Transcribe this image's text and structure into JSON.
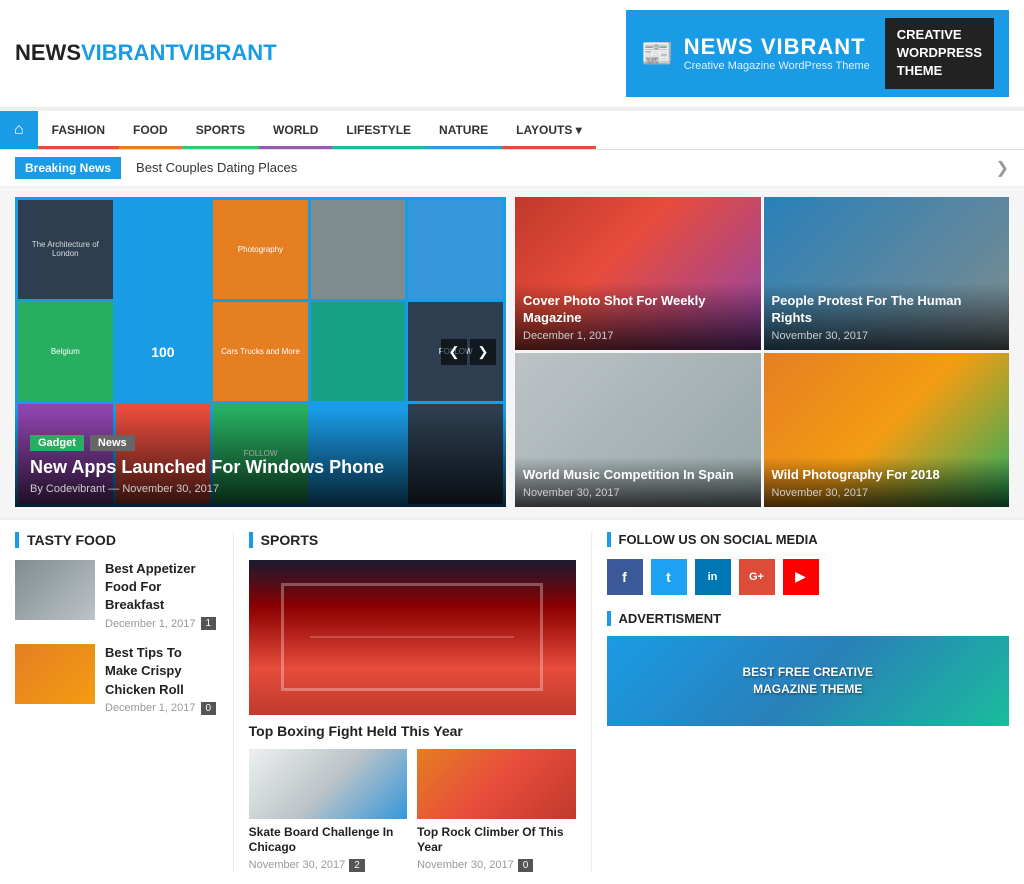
{
  "header": {
    "logo_news": "NEWS",
    "logo_vibrant": "VIBRANT",
    "banner_title": "NEWS VIBRANT",
    "banner_subtitle": "Creative Magazine WordPress Theme",
    "banner_right_line1": "CREATIVE",
    "banner_right_line2": "WORDPRESS",
    "banner_right_line3": "THEME"
  },
  "nav": {
    "home_icon": "⌂",
    "items": [
      {
        "label": "FASHION"
      },
      {
        "label": "FOOD"
      },
      {
        "label": "SPORTS"
      },
      {
        "label": "WORLD"
      },
      {
        "label": "LIFESTYLE"
      },
      {
        "label": "NATURE"
      },
      {
        "label": "LAYOUTS ▾"
      }
    ]
  },
  "breaking": {
    "label": "Breaking News",
    "text": "Best Couples Dating Places",
    "arrow": "❯"
  },
  "hero": {
    "badge1": "Gadget",
    "badge2": "News",
    "title": "New Apps Launched For Windows Phone",
    "author": "By Codevibrant",
    "date": "November 30, 2017",
    "prev": "❮",
    "next": "❯"
  },
  "grid_articles": [
    {
      "title": "Cover Photo Shot For Weekly Magazine",
      "date": "December 1, 2017",
      "color": "ph-woman"
    },
    {
      "title": "People Protest For The Human Rights",
      "date": "November 30, 2017",
      "color": "ph-protest"
    },
    {
      "title": "World Music Competition In Spain",
      "date": "November 30, 2017",
      "color": "ph-violin"
    },
    {
      "title": "Wild Photography For 2018",
      "date": "November 30, 2017",
      "color": "ph-tiger"
    }
  ],
  "tasty_food": {
    "section_title": "TASTY FOOD",
    "articles": [
      {
        "title": "Best Appetizer Food For Breakfast",
        "date": "December 1, 2017",
        "count": "1",
        "color": "ph-food1"
      },
      {
        "title": "Best Tips To Make Crispy Chicken Roll",
        "date": "December 1, 2017",
        "count": "0",
        "color": "ph-food2"
      }
    ]
  },
  "sports": {
    "section_title": "SPORTS",
    "main_title": "Top Boxing Fight Held This Year",
    "articles": [
      {
        "title": "Skate Board Challenge In Chicago",
        "date": "November 30, 2017",
        "count": "2",
        "color": "ph-ski"
      },
      {
        "title": "Top Rock Climber Of This Year",
        "date": "November 30, 2017",
        "count": "0",
        "color": "ph-climber"
      }
    ]
  },
  "sidebar": {
    "social_title": "FOLLOW US ON SOCIAL MEDIA",
    "social_icons": [
      {
        "label": "f",
        "class": "si-fb"
      },
      {
        "label": "t",
        "class": "si-tw"
      },
      {
        "label": "in",
        "class": "si-li"
      },
      {
        "label": "G+",
        "class": "si-gp"
      },
      {
        "label": "▶",
        "class": "si-yt"
      }
    ],
    "adv_title": "ADVERTISMENT",
    "adv_text": "BEST FREE CREATIVE MAGAZINE THEME"
  },
  "tiles": [
    {
      "text": "The Architecture of London",
      "class": "tile-dark"
    },
    {
      "text": "",
      "class": "tile-blue"
    },
    {
      "text": "Photography",
      "class": "tile-orange"
    },
    {
      "text": "",
      "class": "tile-gray"
    },
    {
      "text": "",
      "class": "tile-blue"
    },
    {
      "text": "Belgium",
      "class": "tile-green"
    },
    {
      "text": "100",
      "class": "tile-blue"
    },
    {
      "text": "Cars Trucks and More",
      "class": "tile-orange"
    },
    {
      "text": "",
      "class": "tile-teal"
    },
    {
      "text": "FOLLOW",
      "class": "tile-dark"
    },
    {
      "text": "",
      "class": "tile-purple"
    },
    {
      "text": "",
      "class": "tile-red"
    },
    {
      "text": "FOLLOW",
      "class": "tile-green"
    },
    {
      "text": "",
      "class": "tile-blue"
    },
    {
      "text": "",
      "class": "tile-dark"
    }
  ]
}
